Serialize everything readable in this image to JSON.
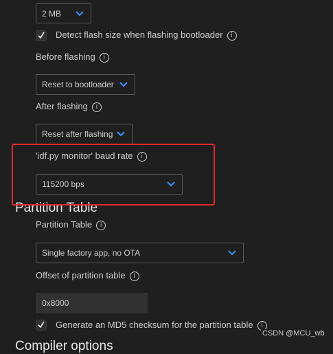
{
  "flash_size": {
    "value": "2 MB"
  },
  "detect_flash": {
    "label": "Detect flash size when flashing bootloader",
    "checked": true
  },
  "before_flashing": {
    "label": "Before flashing",
    "value": "Reset to bootloader"
  },
  "after_flashing": {
    "label": "After flashing",
    "value": "Reset after flashing"
  },
  "monitor_baud": {
    "label": "'idf.py monitor' baud rate",
    "value": "115200 bps"
  },
  "partition_section": {
    "heading": "Partition Table"
  },
  "partition_table": {
    "label": "Partition Table",
    "value": "Single factory app, no OTA"
  },
  "partition_offset": {
    "label": "Offset of partition table",
    "value": "0x8000"
  },
  "md5_checksum": {
    "label": "Generate an MD5 checksum for the partition table",
    "checked": true
  },
  "next_section": {
    "heading": "Compiler options"
  },
  "watermark": {
    "text": "CSDN @MCU_wb"
  },
  "icons": {
    "info": "info-icon",
    "chevron": "chevron-down-icon",
    "check": "checkmark-icon"
  },
  "colors": {
    "background": "#1f1f1f",
    "text": "#cccccc",
    "chevron": "#3794ff",
    "highlight": "#e0282a",
    "input_bg": "#313131"
  }
}
